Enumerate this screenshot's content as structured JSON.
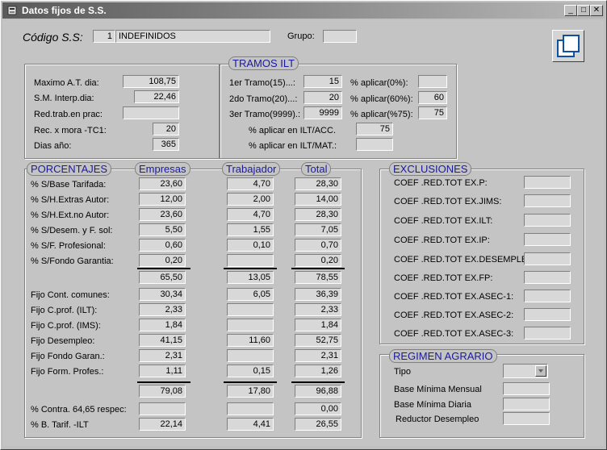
{
  "window": {
    "title": "Datos fijos de S.S.",
    "icon": "app-icon",
    "controls": [
      "_",
      "□",
      "✕"
    ]
  },
  "header": {
    "codigo_label": "Código S.S:",
    "codigo_value": "1",
    "codigo_desc": "INDEFINIDOS",
    "grupo_label": "Grupo:",
    "grupo_value": ""
  },
  "general": {
    "rows": [
      {
        "label": "Maximo A.T. dia:",
        "value": "108,75"
      },
      {
        "label": "S.M. Interp.dia:",
        "value": "22,46"
      },
      {
        "label": "Red.trab.en prac:",
        "value": ""
      },
      {
        "label": "Rec. x mora -TC1:",
        "value": "20"
      },
      {
        "label": "Dias año:",
        "value": "365"
      }
    ]
  },
  "tramos": {
    "title": "TRAMOS ILT",
    "rows": [
      {
        "label": "1er Tramo(15)...:",
        "value": "15",
        "pct_label": "% aplicar(0%):",
        "pct_value": ""
      },
      {
        "label": "2do Tramo(20)...:",
        "value": "20",
        "pct_label": "% aplicar(60%):",
        "pct_value": "60"
      },
      {
        "label": "3er Tramo(9999).:",
        "value": "9999",
        "pct_label": "% aplicar(%75):",
        "pct_value": "75"
      }
    ],
    "acc_label": "% aplicar en ILT/ACC.",
    "acc_value": "75",
    "mat_label": "% aplicar en ILT/MAT.:",
    "mat_value": ""
  },
  "porcentajes": {
    "title": "PORCENTAJES",
    "col_empresas": "Empresas",
    "col_trabajador": "Trabajador",
    "col_total": "Total",
    "rows1": [
      {
        "label": "% S/Base Tarifada:",
        "e": "23,60",
        "t": "4,70",
        "tot": "28,30"
      },
      {
        "label": "% S/H.Extras Autor:",
        "e": "12,00",
        "t": "2,00",
        "tot": "14,00"
      },
      {
        "label": "% S/H.Ext.no Autor:",
        "e": "23,60",
        "t": "4,70",
        "tot": "28,30"
      },
      {
        "label": "% S/Desem. y F. sol:",
        "e": "5,50",
        "t": "1,55",
        "tot": "7,05"
      },
      {
        "label": "% S/F. Profesional:",
        "e": "0,60",
        "t": "0,10",
        "tot": "0,70"
      },
      {
        "label": "% S/Fondo Garantia:",
        "e": "0,20",
        "t": "",
        "tot": "0,20"
      }
    ],
    "sum1": {
      "e": "65,50",
      "t": "13,05",
      "tot": "78,55"
    },
    "rows2": [
      {
        "label": "Fijo Cont. comunes:",
        "e": "30,34",
        "t": "6,05",
        "tot": "36,39"
      },
      {
        "label": "Fijo   C.prof. (ILT):",
        "e": "2,33",
        "t": "",
        "tot": "2,33"
      },
      {
        "label": "Fijo   C.prof. (IMS):",
        "e": "1,84",
        "t": "",
        "tot": "1,84"
      },
      {
        "label": "Fijo  Desempleo:",
        "e": "41,15",
        "t": "11,60",
        "tot": "52,75"
      },
      {
        "label": "Fijo  Fondo Garan.:",
        "e": "2,31",
        "t": "",
        "tot": "2,31"
      },
      {
        "label": "Fijo Form. Profes.:",
        "e": "1,11",
        "t": "0,15",
        "tot": "1,26"
      }
    ],
    "sum2": {
      "e": "79,08",
      "t": "17,80",
      "tot": "96,88"
    },
    "contra": {
      "label": "% Contra. 64,65 respec:",
      "e": "",
      "t": "",
      "tot": "0,00"
    },
    "btarif": {
      "label": "% B. Tarif. -ILT",
      "e": "22,14",
      "t": "4,41",
      "tot": "26,55"
    }
  },
  "exclusiones": {
    "title": "EXCLUSIONES",
    "rows": [
      {
        "label": "COEF .RED.TOT EX.P:",
        "value": ""
      },
      {
        "label": "COEF .RED.TOT EX.JIMS:",
        "value": ""
      },
      {
        "label": "COEF .RED.TOT EX.ILT:",
        "value": ""
      },
      {
        "label": "COEF .RED.TOT EX.IP:",
        "value": ""
      },
      {
        "label": "COEF .RED.TOT EX.DESEMPLEO:",
        "value": ""
      },
      {
        "label": "COEF .RED.TOT EX.FP:",
        "value": ""
      },
      {
        "label": "COEF .RED.TOT EX.ASEC-1:",
        "value": ""
      },
      {
        "label": "COEF .RED.TOT EX.ASEC-2:",
        "value": ""
      },
      {
        "label": "COEF .RED.TOT EX.ASEC-3:",
        "value": ""
      }
    ]
  },
  "agrario": {
    "title": "REGIMEN AGRARIO",
    "tipo_label": "Tipo",
    "tipo_value": "",
    "base_mensual_label": "Base Mínima Mensual",
    "base_mensual_value": "",
    "base_diaria_label": "Base Mínima Diaria",
    "base_diaria_value": "",
    "reductor_label": "Reductor Desempleo",
    "reductor_value": ""
  }
}
